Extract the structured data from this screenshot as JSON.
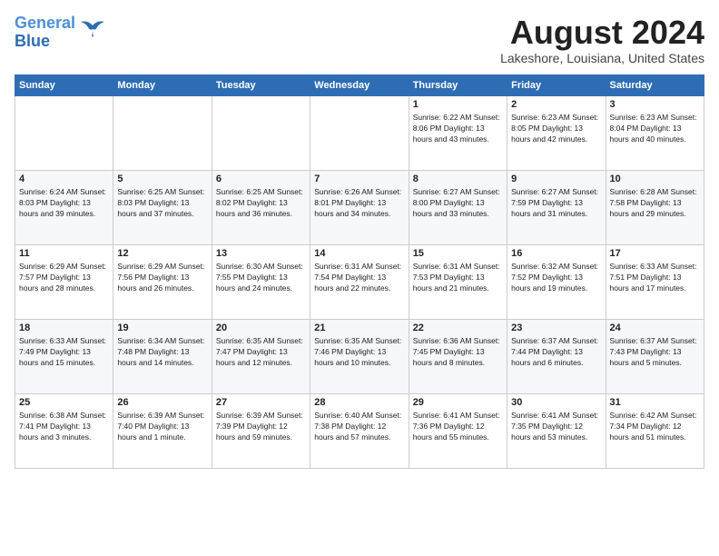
{
  "header": {
    "logo_line1": "General",
    "logo_line2": "Blue",
    "month_year": "August 2024",
    "location": "Lakeshore, Louisiana, United States"
  },
  "days_of_week": [
    "Sunday",
    "Monday",
    "Tuesday",
    "Wednesday",
    "Thursday",
    "Friday",
    "Saturday"
  ],
  "weeks": [
    [
      {
        "day": "",
        "info": ""
      },
      {
        "day": "",
        "info": ""
      },
      {
        "day": "",
        "info": ""
      },
      {
        "day": "",
        "info": ""
      },
      {
        "day": "1",
        "info": "Sunrise: 6:22 AM\nSunset: 8:06 PM\nDaylight: 13 hours\nand 43 minutes."
      },
      {
        "day": "2",
        "info": "Sunrise: 6:23 AM\nSunset: 8:05 PM\nDaylight: 13 hours\nand 42 minutes."
      },
      {
        "day": "3",
        "info": "Sunrise: 6:23 AM\nSunset: 8:04 PM\nDaylight: 13 hours\nand 40 minutes."
      }
    ],
    [
      {
        "day": "4",
        "info": "Sunrise: 6:24 AM\nSunset: 8:03 PM\nDaylight: 13 hours\nand 39 minutes."
      },
      {
        "day": "5",
        "info": "Sunrise: 6:25 AM\nSunset: 8:03 PM\nDaylight: 13 hours\nand 37 minutes."
      },
      {
        "day": "6",
        "info": "Sunrise: 6:25 AM\nSunset: 8:02 PM\nDaylight: 13 hours\nand 36 minutes."
      },
      {
        "day": "7",
        "info": "Sunrise: 6:26 AM\nSunset: 8:01 PM\nDaylight: 13 hours\nand 34 minutes."
      },
      {
        "day": "8",
        "info": "Sunrise: 6:27 AM\nSunset: 8:00 PM\nDaylight: 13 hours\nand 33 minutes."
      },
      {
        "day": "9",
        "info": "Sunrise: 6:27 AM\nSunset: 7:59 PM\nDaylight: 13 hours\nand 31 minutes."
      },
      {
        "day": "10",
        "info": "Sunrise: 6:28 AM\nSunset: 7:58 PM\nDaylight: 13 hours\nand 29 minutes."
      }
    ],
    [
      {
        "day": "11",
        "info": "Sunrise: 6:29 AM\nSunset: 7:57 PM\nDaylight: 13 hours\nand 28 minutes."
      },
      {
        "day": "12",
        "info": "Sunrise: 6:29 AM\nSunset: 7:56 PM\nDaylight: 13 hours\nand 26 minutes."
      },
      {
        "day": "13",
        "info": "Sunrise: 6:30 AM\nSunset: 7:55 PM\nDaylight: 13 hours\nand 24 minutes."
      },
      {
        "day": "14",
        "info": "Sunrise: 6:31 AM\nSunset: 7:54 PM\nDaylight: 13 hours\nand 22 minutes."
      },
      {
        "day": "15",
        "info": "Sunrise: 6:31 AM\nSunset: 7:53 PM\nDaylight: 13 hours\nand 21 minutes."
      },
      {
        "day": "16",
        "info": "Sunrise: 6:32 AM\nSunset: 7:52 PM\nDaylight: 13 hours\nand 19 minutes."
      },
      {
        "day": "17",
        "info": "Sunrise: 6:33 AM\nSunset: 7:51 PM\nDaylight: 13 hours\nand 17 minutes."
      }
    ],
    [
      {
        "day": "18",
        "info": "Sunrise: 6:33 AM\nSunset: 7:49 PM\nDaylight: 13 hours\nand 15 minutes."
      },
      {
        "day": "19",
        "info": "Sunrise: 6:34 AM\nSunset: 7:48 PM\nDaylight: 13 hours\nand 14 minutes."
      },
      {
        "day": "20",
        "info": "Sunrise: 6:35 AM\nSunset: 7:47 PM\nDaylight: 13 hours\nand 12 minutes."
      },
      {
        "day": "21",
        "info": "Sunrise: 6:35 AM\nSunset: 7:46 PM\nDaylight: 13 hours\nand 10 minutes."
      },
      {
        "day": "22",
        "info": "Sunrise: 6:36 AM\nSunset: 7:45 PM\nDaylight: 13 hours\nand 8 minutes."
      },
      {
        "day": "23",
        "info": "Sunrise: 6:37 AM\nSunset: 7:44 PM\nDaylight: 13 hours\nand 6 minutes."
      },
      {
        "day": "24",
        "info": "Sunrise: 6:37 AM\nSunset: 7:43 PM\nDaylight: 13 hours\nand 5 minutes."
      }
    ],
    [
      {
        "day": "25",
        "info": "Sunrise: 6:38 AM\nSunset: 7:41 PM\nDaylight: 13 hours\nand 3 minutes."
      },
      {
        "day": "26",
        "info": "Sunrise: 6:39 AM\nSunset: 7:40 PM\nDaylight: 13 hours\nand 1 minute."
      },
      {
        "day": "27",
        "info": "Sunrise: 6:39 AM\nSunset: 7:39 PM\nDaylight: 12 hours\nand 59 minutes."
      },
      {
        "day": "28",
        "info": "Sunrise: 6:40 AM\nSunset: 7:38 PM\nDaylight: 12 hours\nand 57 minutes."
      },
      {
        "day": "29",
        "info": "Sunrise: 6:41 AM\nSunset: 7:36 PM\nDaylight: 12 hours\nand 55 minutes."
      },
      {
        "day": "30",
        "info": "Sunrise: 6:41 AM\nSunset: 7:35 PM\nDaylight: 12 hours\nand 53 minutes."
      },
      {
        "day": "31",
        "info": "Sunrise: 6:42 AM\nSunset: 7:34 PM\nDaylight: 12 hours\nand 51 minutes."
      }
    ]
  ]
}
